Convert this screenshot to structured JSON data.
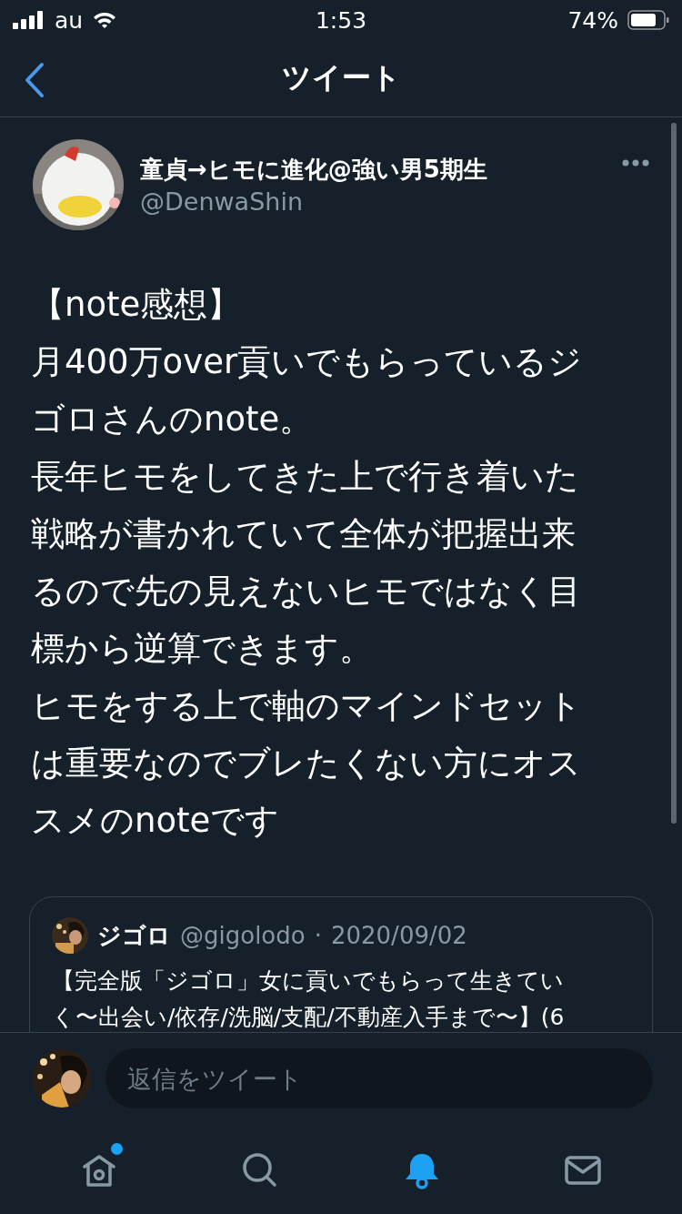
{
  "status_bar": {
    "carrier": "au",
    "time": "1:53",
    "battery": "74%"
  },
  "nav": {
    "title": "ツイート"
  },
  "tweet": {
    "author": {
      "name": "童貞→ヒモに進化@強い男5期生",
      "handle": "@DenwaShin"
    },
    "text_lines": [
      "【note感想】",
      "月400万over貢いでもらっているジ",
      "ゴロさんのnote。",
      "長年ヒモをしてきた上で行き着いた",
      "戦略が書かれていて全体が把握出来",
      "るので先の見えないヒモではなく目",
      "標から逆算できます。",
      "ヒモをする上で軸のマインドセット",
      "は重要なのでブレたくない方にオス",
      "スメのnoteです"
    ],
    "quote": {
      "name": "ジゴロ",
      "handle": "@gigolodo",
      "separator": "·",
      "date": "2020/09/02",
      "text_lines": [
        "【完全版「ジゴロ」女に貢いでもらって生きてい",
        "く〜出会い/依存/洗脳/支配/不動産入手まで〜】(6"
      ]
    }
  },
  "reply": {
    "placeholder": "返信をツイート"
  },
  "tabs": [
    {
      "kind": "home",
      "selected": false,
      "badge": true
    },
    {
      "kind": "search",
      "selected": false,
      "badge": false
    },
    {
      "kind": "notifications",
      "selected": true,
      "badge": false
    },
    {
      "kind": "messages",
      "selected": false,
      "badge": false
    }
  ]
}
